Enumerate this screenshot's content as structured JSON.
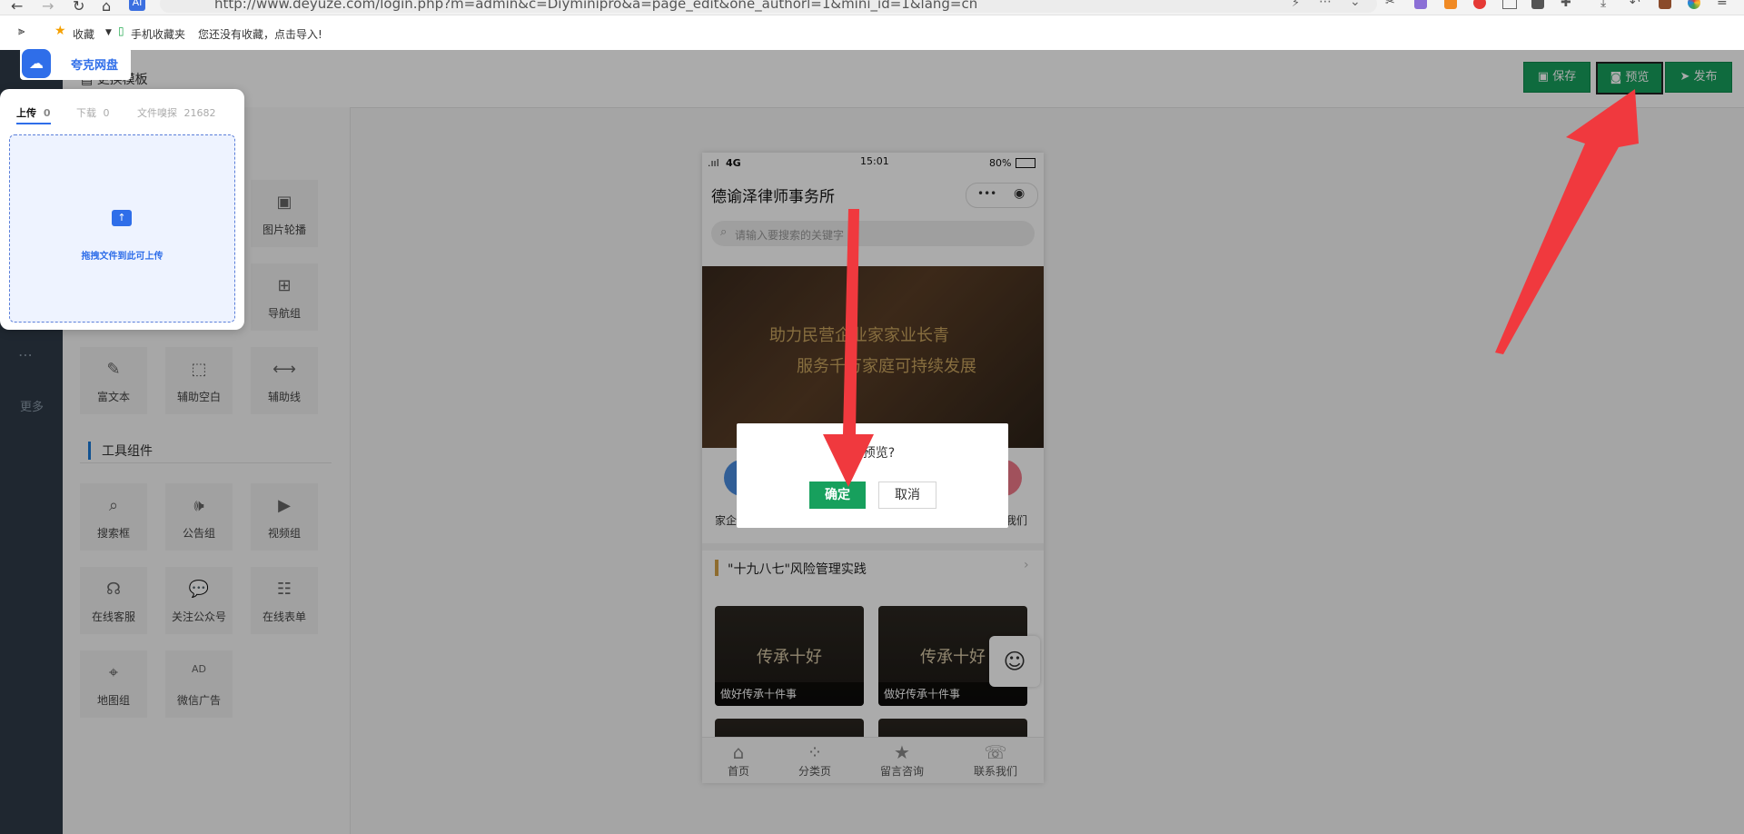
{
  "browser": {
    "url": "http://www.deyuze.com/login.php?m=admin&c=Diyminipro&a=page_edit&one_authorl=1&mini_id=1&lang=cn",
    "bookmarks": [
      {
        "label": "收藏"
      },
      {
        "label": "手机收藏夹"
      },
      {
        "label": "您还没有收藏，点击导入!"
      }
    ]
  },
  "app": {
    "page_header_label": "更换模板",
    "sidebar_more": "更多",
    "toolbar": {
      "save_label": "保存",
      "preview_label": "预览",
      "publish_label": "发布"
    },
    "components": [
      {
        "label": "图片轮播",
        "icon": "image-carousel-icon",
        "glyph": "▣"
      },
      {
        "label": "导航组",
        "icon": "grid-icon",
        "glyph": "⊞"
      },
      {
        "label": "富文本",
        "icon": "edit-icon",
        "glyph": "✎"
      },
      {
        "label": "辅助空白",
        "icon": "blank-icon",
        "glyph": "⬚"
      },
      {
        "label": "辅助线",
        "icon": "line-icon",
        "glyph": "⟷"
      }
    ],
    "tools_section_title": "工具组件",
    "tools": [
      {
        "label": "搜索框",
        "icon": "search-icon",
        "glyph": "⌕"
      },
      {
        "label": "公告组",
        "icon": "speaker-icon",
        "glyph": "🕪"
      },
      {
        "label": "视频组",
        "icon": "play-icon",
        "glyph": "▶"
      },
      {
        "label": "在线客服",
        "icon": "headset-icon",
        "glyph": "☊"
      },
      {
        "label": "关注公众号",
        "icon": "wechat-icon",
        "glyph": "💬"
      },
      {
        "label": "在线表单",
        "icon": "form-icon",
        "glyph": "☷"
      },
      {
        "label": "地图组",
        "icon": "map-pin-icon",
        "glyph": "⌖"
      },
      {
        "label": "微信广告",
        "icon": "ad-icon",
        "glyph": "AD"
      }
    ]
  },
  "phone": {
    "signal": "4G",
    "time": "15:01",
    "battery": "80%",
    "title": "德谕泽律师事务所",
    "menu_dots": "•••",
    "search_placeholder": "请输入要搜索的关键字",
    "banner_line1": "助力民营企业家家业长青",
    "banner_line2": "服务千万家庭可持续发展",
    "nav_left_label": "家企",
    "nav_right_label": "我们",
    "section_title": "\"十九八七\"风险管理实践",
    "cards": [
      {
        "big": "传承十好",
        "caption": "做好传承十件事"
      },
      {
        "big": "传承十好",
        "caption": "做好传承十件事"
      }
    ],
    "tabs": [
      {
        "label": "首页",
        "icon": "home-icon",
        "glyph": "⌂"
      },
      {
        "label": "分类页",
        "icon": "category-icon",
        "glyph": "⁘"
      },
      {
        "label": "留言咨询",
        "icon": "star-icon",
        "glyph": "★"
      },
      {
        "label": "联系我们",
        "icon": "contact-icon",
        "glyph": "☏"
      }
    ]
  },
  "dialog": {
    "message": "并预览?",
    "ok_label": "确定",
    "cancel_label": "取消"
  },
  "quark": {
    "brand": "夸克网盘",
    "tabs": [
      {
        "label": "上传",
        "count": "0"
      },
      {
        "label": "下载",
        "count": "0"
      },
      {
        "label": "文件嗅探",
        "count": "21682"
      }
    ],
    "drop_hint": "拖拽文件到此可上传"
  },
  "colors": {
    "accent_green": "#17a05d",
    "annotation_red": "#f0393e",
    "quark_blue": "#2f6ee9"
  }
}
